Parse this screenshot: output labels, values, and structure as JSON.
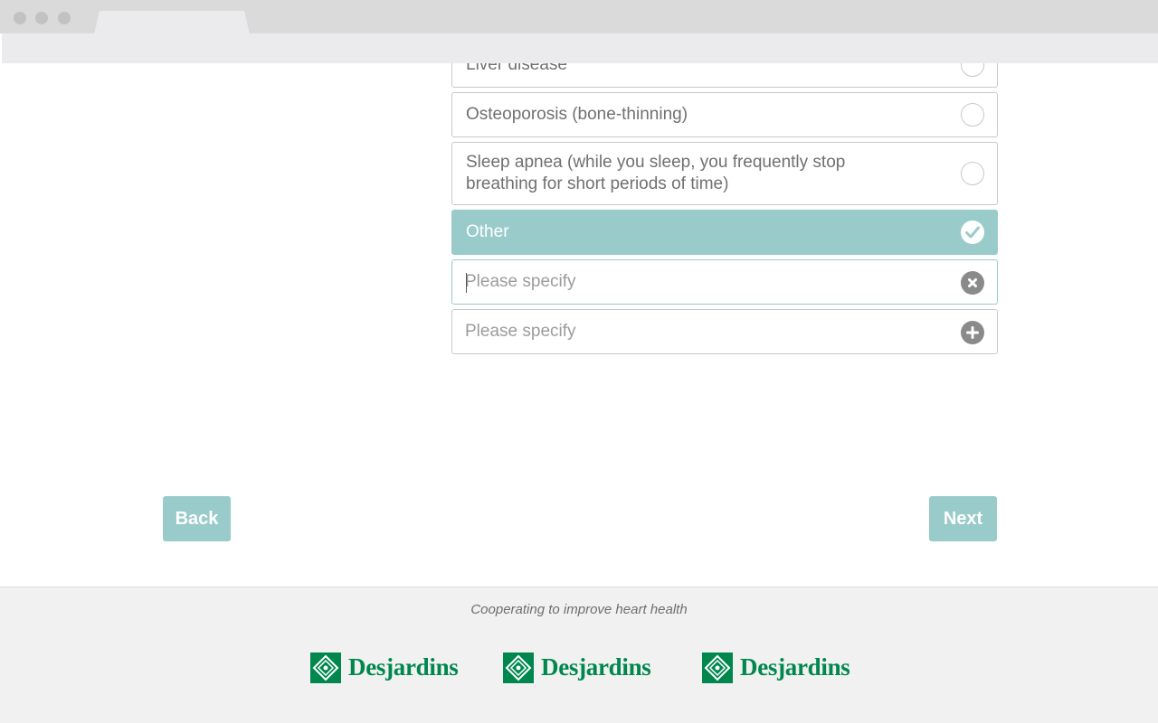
{
  "options": [
    {
      "label": "Liver disease",
      "selected": false
    },
    {
      "label": "Osteoporosis (bone-thinning)",
      "selected": false
    },
    {
      "label": "Sleep apnea (while you sleep, you frequently stop breathing for short periods of time)",
      "selected": false
    },
    {
      "label": "Other",
      "selected": true
    }
  ],
  "specify_fields": [
    {
      "placeholder": "Please specify",
      "value": "",
      "action_icon": "clear-icon"
    },
    {
      "placeholder": "Please specify",
      "value": "",
      "action_icon": "add-icon"
    }
  ],
  "nav": {
    "back_label": "Back",
    "next_label": "Next"
  },
  "footer": {
    "tagline": "Cooperating to improve heart health",
    "logos": [
      "Desjardins",
      "Desjardins",
      "Desjardins"
    ]
  },
  "colors": {
    "accent": "#9acbcb",
    "brand_green": "#00874e",
    "footer_bg": "#f1f1f1"
  }
}
